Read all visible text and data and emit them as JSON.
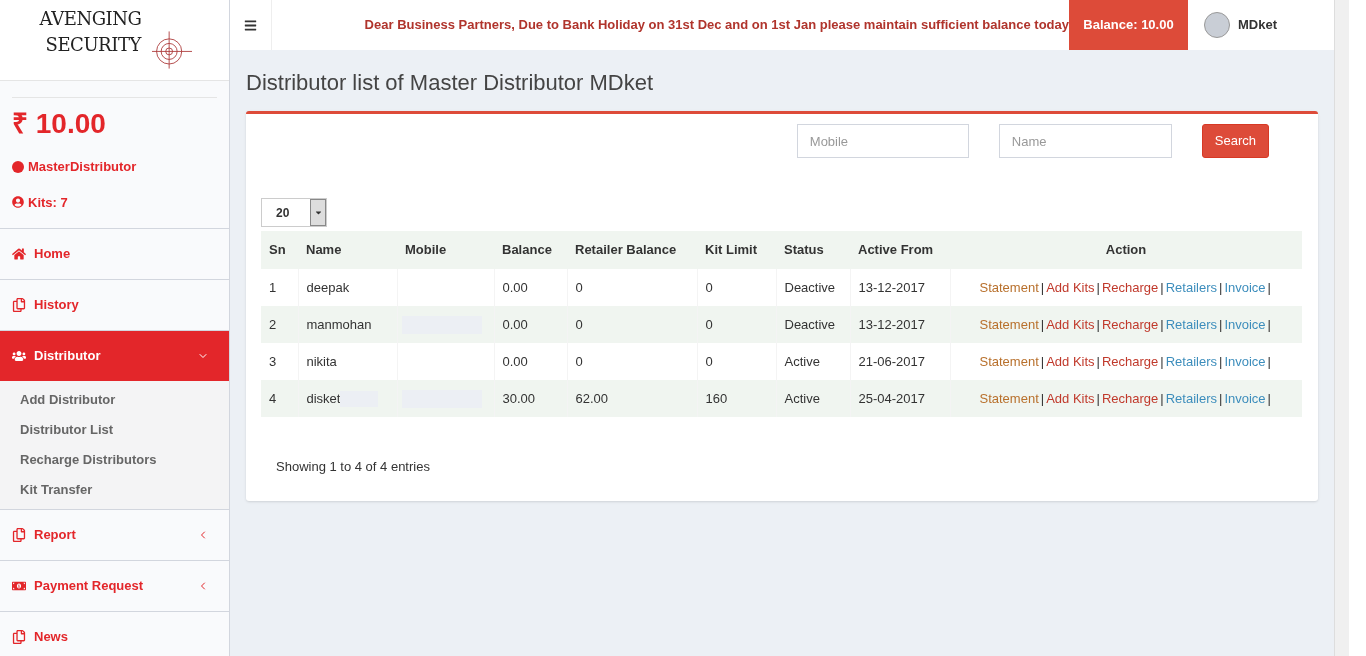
{
  "logo": {
    "line1": "AVENGING",
    "line2": "SECURITY"
  },
  "wallet": {
    "amount": "₹ 10.00",
    "role": "MasterDistributor",
    "kits": "Kits: 7"
  },
  "sidebar": {
    "items": [
      {
        "label": "Home",
        "selected": false
      },
      {
        "label": "History",
        "selected": false
      },
      {
        "label": "Distributor",
        "selected": true,
        "expanded": true,
        "children": [
          {
            "label": "Add Distributor"
          },
          {
            "label": "Distributor List"
          },
          {
            "label": "Recharge Distributors"
          },
          {
            "label": "Kit Transfer"
          }
        ]
      },
      {
        "label": "Report",
        "selected": false,
        "expanded": false
      },
      {
        "label": "Payment Request",
        "selected": false,
        "expanded": false
      },
      {
        "label": "News",
        "selected": false
      }
    ]
  },
  "header": {
    "notice": "Dear Business Partners, Due to Bank Holiday on 31st Dec and on 1st Jan please maintain sufficient balance today",
    "balance": "Balance: 10.00",
    "user": "MDket"
  },
  "page_title": "Distributor list of Master Distributor MDket",
  "filters": {
    "mobile_placeholder": "Mobile",
    "name_placeholder": "Name",
    "search_button": "Search"
  },
  "page_size": "20",
  "table": {
    "columns": [
      "Sn",
      "Name",
      "Mobile",
      "Balance",
      "Retailer Balance",
      "Kit Limit",
      "Status",
      "Active From",
      "Action"
    ],
    "rows": [
      {
        "sn": "1",
        "name": "deepak",
        "name_redacted": false,
        "mobile_redacted": false,
        "balance": "0.00",
        "retailer_balance": "0",
        "kit_limit": "0",
        "status": "Deactive",
        "active_from": "13-12-2017",
        "actions": [
          {
            "label": "Statement",
            "color": "#b8702c"
          },
          {
            "label": "Add Kits",
            "color": "#c0392b"
          },
          {
            "label": "Recharge",
            "color": "#c0392b"
          },
          {
            "label": "Retailers",
            "color": "#3c8dbc"
          },
          {
            "label": "Invoice",
            "color": "#3c8dbc"
          }
        ],
        "separators": [
          "|",
          "|",
          "|",
          "|",
          "|"
        ]
      },
      {
        "sn": "2",
        "name": "manmohan",
        "name_redacted": false,
        "mobile_redacted": true,
        "balance": "0.00",
        "retailer_balance": "0",
        "kit_limit": "0",
        "status": "Deactive",
        "active_from": "13-12-2017",
        "actions": [
          {
            "label": "Statement",
            "color": "#b8702c"
          },
          {
            "label": "Add Kits",
            "color": "#c0392b"
          },
          {
            "label": "Recharge",
            "color": "#c0392b"
          },
          {
            "label": "Retailers",
            "color": "#3c8dbc"
          },
          {
            "label": "Invoice",
            "color": "#3c8dbc"
          }
        ],
        "separators": [
          "|",
          "|",
          "|",
          "|",
          "|"
        ]
      },
      {
        "sn": "3",
        "name": "nikita",
        "name_redacted": false,
        "mobile_redacted": false,
        "balance": "0.00",
        "retailer_balance": "0",
        "kit_limit": "0",
        "status": "Active",
        "active_from": "21-06-2017",
        "actions": [
          {
            "label": "Statement",
            "color": "#b8702c"
          },
          {
            "label": "Add Kits",
            "color": "#c0392b"
          },
          {
            "label": "Recharge",
            "color": "#c0392b"
          },
          {
            "label": "Retailers",
            "color": "#3c8dbc"
          },
          {
            "label": "Invoice",
            "color": "#3c8dbc"
          }
        ],
        "separators": [
          "|",
          "|",
          "|",
          "|",
          "|"
        ]
      },
      {
        "sn": "4",
        "name": "disket",
        "name_redacted": true,
        "mobile_redacted": true,
        "balance": "30.00",
        "retailer_balance": "62.00",
        "kit_limit": "160",
        "status": "Active",
        "active_from": "25-04-2017",
        "actions": [
          {
            "label": "Statement",
            "color": "#b8702c"
          },
          {
            "label": "Add Kits",
            "color": "#c0392b"
          },
          {
            "label": "Recharge",
            "color": "#c0392b"
          },
          {
            "label": "Retailers",
            "color": "#3c8dbc"
          },
          {
            "label": "Invoice",
            "color": "#3c8dbc"
          }
        ],
        "separators": [
          "|",
          "|",
          "|",
          "|",
          "|"
        ]
      }
    ]
  },
  "footer_info": "Showing 1 to 4 of 4 entries"
}
